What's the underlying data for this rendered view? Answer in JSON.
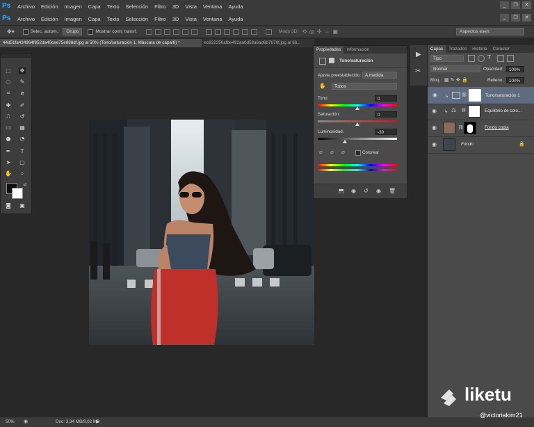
{
  "app": {
    "logo": "Ps"
  },
  "menu": [
    "Archivo",
    "Edición",
    "Imagen",
    "Capa",
    "Texto",
    "Selección",
    "Filtro",
    "3D",
    "Vista",
    "Ventana",
    "Ayuda"
  ],
  "window_buttons": {
    "minimize": "_",
    "restore": "❐",
    "close": "✕"
  },
  "options_bar": {
    "auto_select_label": "Selec. autom.:",
    "auto_select_value": "Grupo",
    "show_transform_label": "Mostrar contr. transf.",
    "mode_3d_label": "Modo 3D:",
    "workspace": "Aspectos esen."
  },
  "document_tabs": [
    {
      "label": "44d51fa434964f852da40cee75e888df.jpg al 50% (Tono/saturación 1, Máscara de capa/8) *",
      "close": "×"
    },
    {
      "label": "ec822250afbe492aa0d58a6ad6b7b76f.jpg al 66...",
      "close": ""
    }
  ],
  "properties": {
    "tabs": [
      "Propiedades",
      "Información"
    ],
    "title": "Tono/saturación",
    "preset_label": "Ajuste preestablecido:",
    "preset_value": "A medida",
    "channel_value": "Todos",
    "hue_label": "Tono:",
    "hue_value": "0",
    "saturation_label": "Saturación:",
    "saturation_value": "0",
    "lightness_label": "Luminosidad:",
    "lightness_value": "-30",
    "colorize_label": "Colorear"
  },
  "layers_panel": {
    "tabs": [
      "Capas",
      "Trazados",
      "Historia",
      "Carácter"
    ],
    "kind_value": "Tipo",
    "blend_value": "Normal",
    "opacity_label": "Opacidad:",
    "opacity_value": "100%",
    "lock_label": "Bloq.:",
    "fill_label": "Relleno:",
    "fill_value": "100%",
    "layers": [
      {
        "name": "Tono/saturación 1",
        "selected": true
      },
      {
        "name": "Equilibrio de colo...",
        "selected": false
      },
      {
        "name": "Fondo copia",
        "selected": false
      },
      {
        "name": "Fondo",
        "selected": false
      }
    ]
  },
  "status": {
    "zoom": "50%",
    "doc": "Doc: 3,34 MB/9,02 MB"
  },
  "watermark": {
    "brand": "liketu",
    "user": "@victoriakim21"
  },
  "colors": {
    "accent": "#37a6ff",
    "selected_layer": "#5e6b80"
  }
}
